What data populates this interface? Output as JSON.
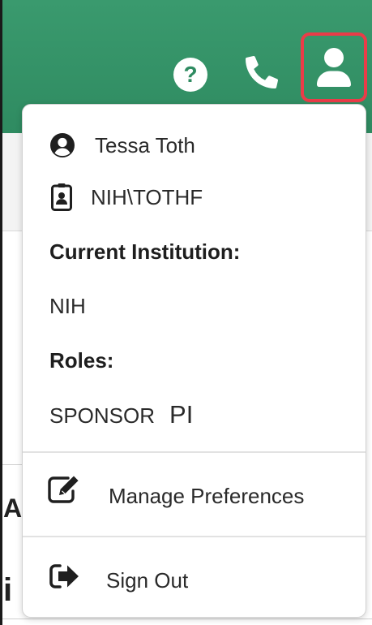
{
  "header": {
    "help_icon": "question-circle-icon",
    "phone_icon": "phone-icon",
    "user_icon": "user-icon",
    "brand_color": "#2f8b61",
    "highlight_color": "#ea3c48"
  },
  "page_behind": {
    "heading_fragment_1": "A",
    "heading_fragment_2": "i"
  },
  "user_menu": {
    "user_name": "Tessa Toth",
    "username": "NIH\\TOTHF",
    "institution_label": "Current Institution:",
    "institution_value": "NIH",
    "roles_label": "Roles:",
    "roles": [
      "SPONSOR",
      "PI"
    ],
    "manage_preferences": "Manage Preferences",
    "sign_out": "Sign Out"
  }
}
